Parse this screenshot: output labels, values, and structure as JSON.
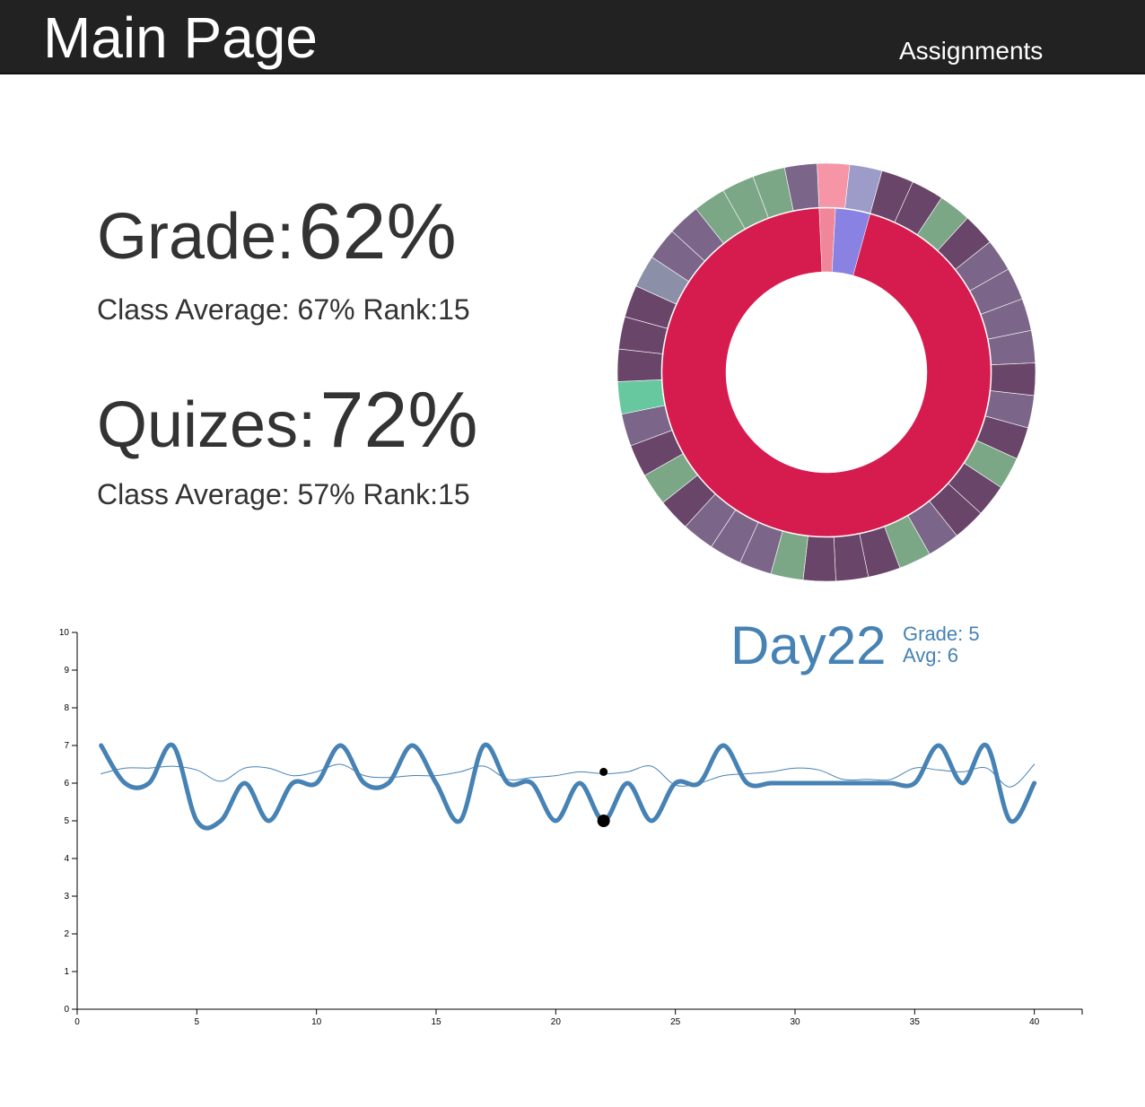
{
  "header": {
    "title": "Main Page",
    "nav_label": "Assignments"
  },
  "stats": {
    "grade": {
      "label": "Grade:",
      "value": "62%",
      "subtitle": "Class Average: 67% Rank:15"
    },
    "quizzes": {
      "label": "Quizes:",
      "value": "72%",
      "subtitle": "Class Average: 57% Rank:15"
    }
  },
  "colors": {
    "header_bg": "#222222",
    "line": "#4682b4",
    "inner_main": "#d61c4e",
    "inner_pink": "#f0869a",
    "inner_blue": "#8a82e2",
    "outer_pink": "#f595a6",
    "outer_lavender": "#9d9cc8",
    "outer_dark": "#6a456a",
    "outer_mid": "#7b6689",
    "outer_green": "#7ba787",
    "outer_teal": "#67c8a0",
    "outer_slate": "#8b8fa8"
  },
  "sunburst": {
    "inner": [
      {
        "value": 1.6,
        "color": "inner_pink"
      },
      {
        "value": 3.4,
        "color": "inner_blue"
      },
      {
        "value": 95.0,
        "color": "inner_main"
      }
    ],
    "outer": [
      "outer_pink",
      "outer_lavender",
      "outer_dark",
      "outer_dark",
      "outer_green",
      "outer_dark",
      "outer_mid",
      "outer_mid",
      "outer_mid",
      "outer_mid",
      "outer_dark",
      "outer_mid",
      "outer_dark",
      "outer_green",
      "outer_dark",
      "outer_dark",
      "outer_mid",
      "outer_green",
      "outer_dark",
      "outer_dark",
      "outer_dark",
      "outer_green",
      "outer_mid",
      "outer_mid",
      "outer_mid",
      "outer_dark",
      "outer_green",
      "outer_dark",
      "outer_mid",
      "outer_teal",
      "outer_dark",
      "outer_dark",
      "outer_dark",
      "outer_slate",
      "outer_mid",
      "outer_mid",
      "outer_green",
      "outer_green",
      "outer_green",
      "outer_mid"
    ]
  },
  "chart_data": {
    "type": "line",
    "xlim": [
      0,
      42
    ],
    "ylim": [
      0,
      10
    ],
    "x_ticks": [
      0,
      5,
      10,
      15,
      20,
      25,
      30,
      35,
      40
    ],
    "y_ticks": [
      0,
      1,
      2,
      3,
      4,
      5,
      6,
      7,
      8,
      9,
      10
    ],
    "x": [
      1,
      2,
      3,
      4,
      5,
      6,
      7,
      8,
      9,
      10,
      11,
      12,
      13,
      14,
      15,
      16,
      17,
      18,
      19,
      20,
      21,
      22,
      23,
      24,
      25,
      26,
      27,
      28,
      29,
      30,
      31,
      32,
      33,
      34,
      35,
      36,
      37,
      38,
      39,
      40
    ],
    "series": [
      {
        "values": [
          7,
          6,
          6,
          7,
          5,
          5,
          6,
          5,
          6,
          6,
          7,
          6,
          6,
          7,
          6,
          5,
          7,
          6,
          6,
          5,
          6,
          5,
          6,
          5,
          6,
          6,
          7,
          6,
          6,
          6,
          6,
          6,
          6,
          6,
          6,
          7,
          6,
          7,
          5,
          6
        ],
        "style": "thick"
      },
      {
        "values": [
          6.25,
          6.4,
          6.4,
          6.45,
          6.35,
          6.05,
          6.4,
          6.4,
          6.2,
          6.3,
          6.5,
          6.2,
          6.15,
          6.2,
          6.2,
          6.3,
          6.45,
          6.1,
          6.15,
          6.2,
          6.3,
          6.25,
          6.3,
          6.45,
          5.95,
          6.0,
          6.2,
          6.25,
          6.3,
          6.4,
          6.35,
          6.1,
          6.1,
          6.1,
          6.4,
          6.35,
          6.3,
          6.4,
          5.9,
          6.5
        ],
        "style": "thin"
      }
    ],
    "highlight": {
      "x": 22,
      "grade": 5,
      "avg": 6.3,
      "title": "Day22",
      "grade_label": "Grade: 5",
      "avg_label": "Avg: 6"
    }
  }
}
